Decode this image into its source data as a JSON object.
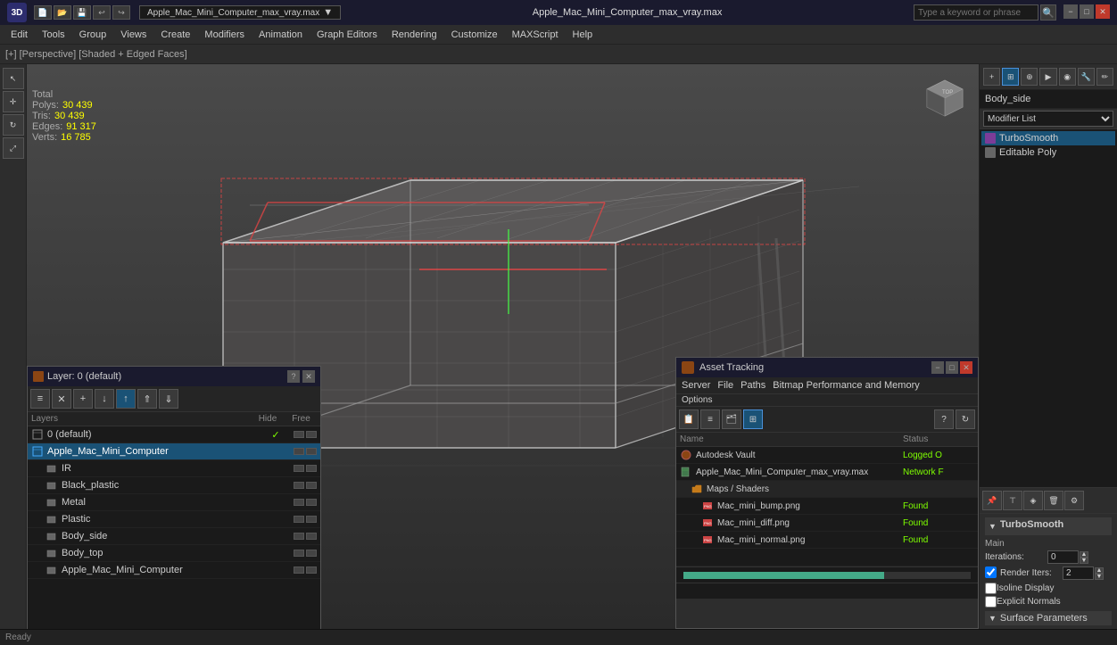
{
  "titlebar": {
    "filename": "Apple_Mac_Mini_Computer_max_vray.max",
    "search_placeholder": "Type a keyword or phrase",
    "min": "−",
    "max": "□",
    "close": "✕"
  },
  "menubar": {
    "items": [
      "Edit",
      "Tools",
      "Group",
      "Views",
      "Create",
      "Modifiers",
      "Animation",
      "Graph Editors",
      "Rendering",
      "Customize",
      "MAXScript",
      "Help"
    ]
  },
  "toolbar_left": {
    "app_icon": "3ds"
  },
  "viewport": {
    "label": "[+] [Perspective] [Shaded + Edged Faces]",
    "stats": {
      "polys_label": "Polys:",
      "polys_value": "30 439",
      "tris_label": "Tris:",
      "tris_value": "30 439",
      "edges_label": "Edges:",
      "edges_value": "91 317",
      "verts_label": "Verts:",
      "verts_value": "16 785",
      "total_label": "Total"
    }
  },
  "right_panel": {
    "object_name": "Body_side",
    "modifier_list_label": "Modifier List",
    "modifiers": [
      {
        "name": "TurboSmooth",
        "type": "turbo"
      },
      {
        "name": "Editable Poly",
        "type": "poly"
      }
    ],
    "turbosmooth": {
      "header": "TurboSmooth",
      "main_label": "Main",
      "iterations_label": "Iterations:",
      "iterations_value": "0",
      "render_iters_label": "Render Iters:",
      "render_iters_value": "2",
      "isoline_label": "Isoline Display",
      "explicit_normals_label": "Explicit Normals",
      "surface_params_label": "Surface Parameters"
    }
  },
  "layers_panel": {
    "title": "Layer: 0 (default)",
    "help_btn": "?",
    "close_btn": "✕",
    "columns": {
      "name": "Layers",
      "hide": "Hide",
      "freeze": "Free"
    },
    "layers": [
      {
        "name": "0 (default)",
        "indent": 0,
        "checked": true,
        "type": "layer"
      },
      {
        "name": "Apple_Mac_Mini_Computer",
        "indent": 0,
        "selected": true,
        "type": "layer"
      },
      {
        "name": "IR",
        "indent": 1,
        "type": "object"
      },
      {
        "name": "Black_plastic",
        "indent": 1,
        "type": "object"
      },
      {
        "name": "Metal",
        "indent": 1,
        "type": "object"
      },
      {
        "name": "Plastic",
        "indent": 1,
        "type": "object"
      },
      {
        "name": "Body_side",
        "indent": 1,
        "type": "object"
      },
      {
        "name": "Body_top",
        "indent": 1,
        "type": "object"
      },
      {
        "name": "Apple_Mac_Mini_Computer",
        "indent": 1,
        "type": "object"
      }
    ]
  },
  "asset_panel": {
    "title": "Asset Tracking",
    "min": "−",
    "max": "□",
    "close": "✕",
    "menu": [
      "Server",
      "File",
      "Paths",
      "Bitmap Performance and Memory",
      "Options"
    ],
    "columns": {
      "name": "Name",
      "status": "Status"
    },
    "rows": [
      {
        "name": "Autodesk Vault",
        "status": "Logged O",
        "indent": 0,
        "type": "vault"
      },
      {
        "name": "Apple_Mac_Mini_Computer_max_vray.max",
        "status": "Network F",
        "indent": 0,
        "type": "file"
      },
      {
        "name": "Maps / Shaders",
        "status": "",
        "indent": 1,
        "type": "folder"
      },
      {
        "name": "Mac_mini_bump.png",
        "status": "Found",
        "indent": 2,
        "type": "texture"
      },
      {
        "name": "Mac_mini_diff.png",
        "status": "Found",
        "indent": 2,
        "type": "texture"
      },
      {
        "name": "Mac_mini_normal.png",
        "status": "Found",
        "indent": 2,
        "type": "texture"
      }
    ]
  }
}
